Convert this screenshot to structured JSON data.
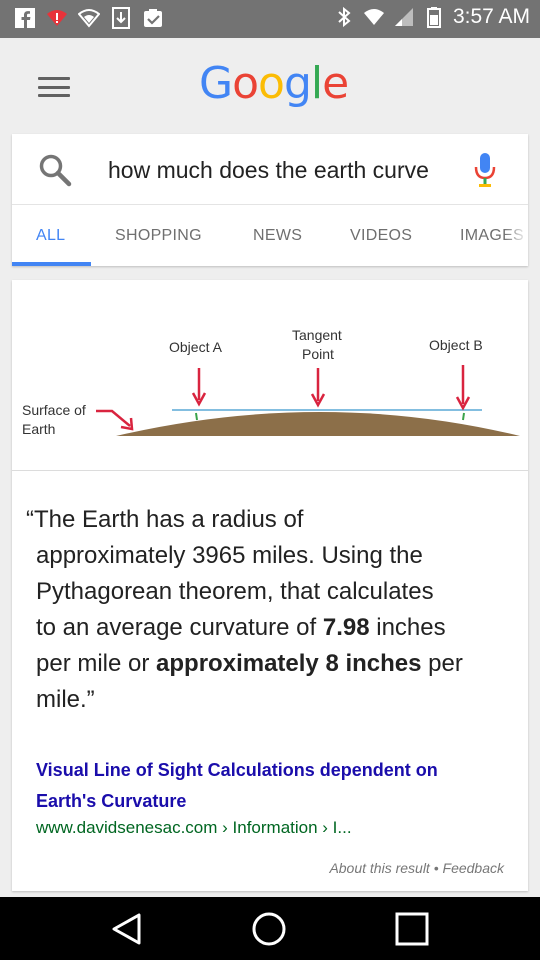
{
  "status_bar": {
    "time": "3:57 AM",
    "left_icons": [
      "facebook-icon",
      "wifi-alert-icon",
      "shield-wifi-icon",
      "download-icon",
      "clipboard-check-icon"
    ],
    "right_icons": [
      "bluetooth-icon",
      "wifi-icon",
      "signal-icon",
      "battery-icon"
    ]
  },
  "header": {
    "logo_letters": [
      {
        "char": "G",
        "color": "#4285f4"
      },
      {
        "char": "o",
        "color": "#ea4335"
      },
      {
        "char": "o",
        "color": "#fbbc05"
      },
      {
        "char": "g",
        "color": "#4285f4"
      },
      {
        "char": "l",
        "color": "#34a853"
      },
      {
        "char": "e",
        "color": "#ea4335"
      }
    ]
  },
  "search": {
    "query": "how much does the earth curve"
  },
  "tabs": [
    {
      "label": "ALL",
      "active": true
    },
    {
      "label": "SHOPPING",
      "active": false
    },
    {
      "label": "NEWS",
      "active": false
    },
    {
      "label": "VIDEOS",
      "active": false
    },
    {
      "label": "IMAGES",
      "active": false
    }
  ],
  "diagram": {
    "label_object_a": "Object A",
    "label_tangent_1": "Tangent",
    "label_tangent_2": "Point",
    "label_object_b": "Object B",
    "label_surface_1": "Surface of",
    "label_surface_2": "Earth",
    "arrow_color": "#d9243f",
    "ground_color": "#8c6f49",
    "tangent_color": "#5aa9d6"
  },
  "snippet": {
    "line1": "“The Earth has a radius of",
    "line2": "approximately 3965 miles. Using the",
    "line3": "Pythagorean theorem, that calculates",
    "line4_pre": "to an average curvature of ",
    "line4_bold": "7.98",
    "line4_post": " inches",
    "line5_pre": "per mile or ",
    "line5_bold": "approximately 8 inches",
    "line5_post": " per",
    "line6": "mile.”"
  },
  "source": {
    "title_line1": "Visual Line of Sight Calculations dependent on",
    "title_line2": "Earth's Curvature",
    "url": "www.davidsenesac.com › Information › I..."
  },
  "about": {
    "about_label": "About this result",
    "separator": " • ",
    "feedback_label": "Feedback"
  },
  "nav_bar": {
    "buttons": [
      "back-icon",
      "home-icon",
      "recents-icon"
    ]
  }
}
